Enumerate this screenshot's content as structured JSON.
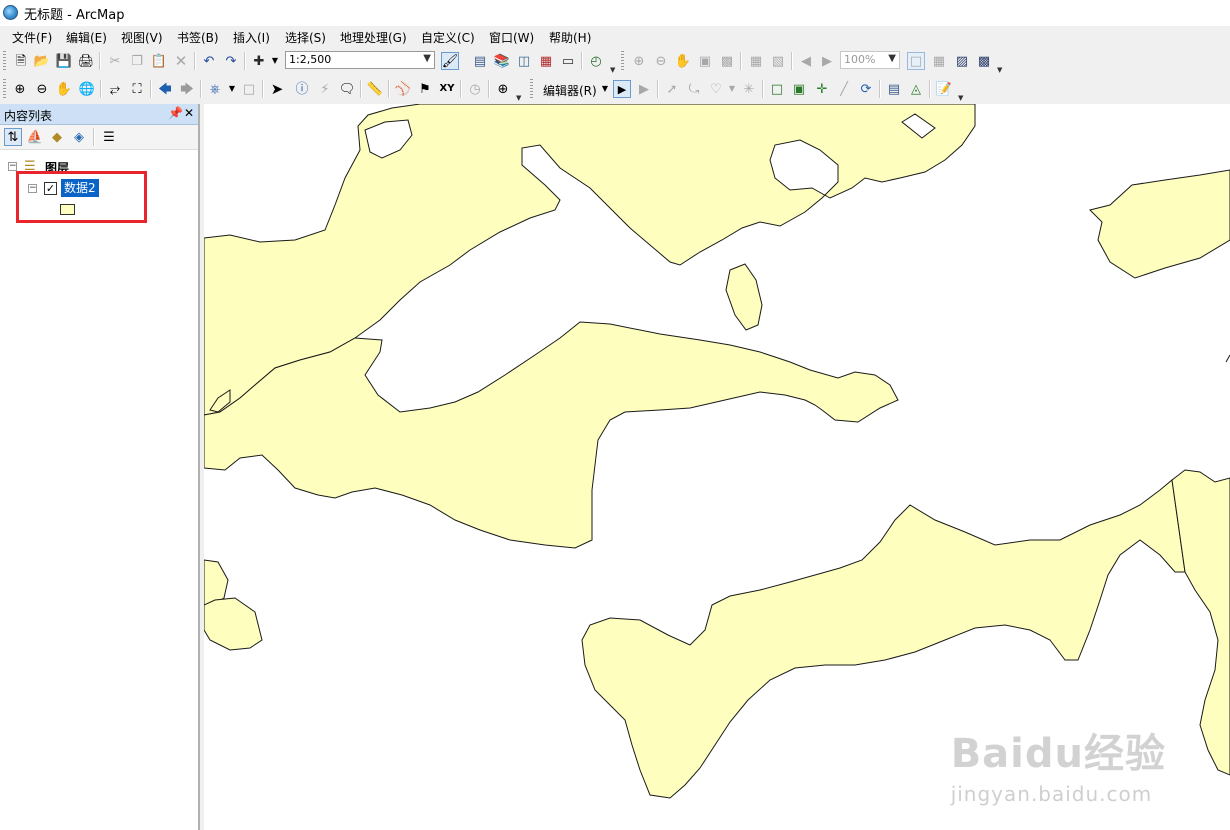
{
  "window": {
    "title": "无标题 - ArcMap"
  },
  "menu": [
    "文件(F)",
    "编辑(E)",
    "视图(V)",
    "书签(B)",
    "插入(I)",
    "选择(S)",
    "地理处理(G)",
    "自定义(C)",
    "窗口(W)",
    "帮助(H)"
  ],
  "toolbar": {
    "scale_value": "1:2,500",
    "zoom_value": "100%",
    "editor_label": "编辑器(R)"
  },
  "toc": {
    "title": "内容列表",
    "pin_icon": "pin-icon",
    "close_icon": "close-icon",
    "root_label": "图层",
    "layer_name": "数据2",
    "layer_checked": true
  },
  "colors": {
    "polygon_fill": "#fefebe",
    "polygon_stroke": "#1a1a1a",
    "selection": "#0a64c8",
    "panel_header": "#cde0f5",
    "highlight": "#e8252d"
  },
  "watermark": {
    "brand": "Baidu经验",
    "url": "jingyan.baidu.com"
  }
}
